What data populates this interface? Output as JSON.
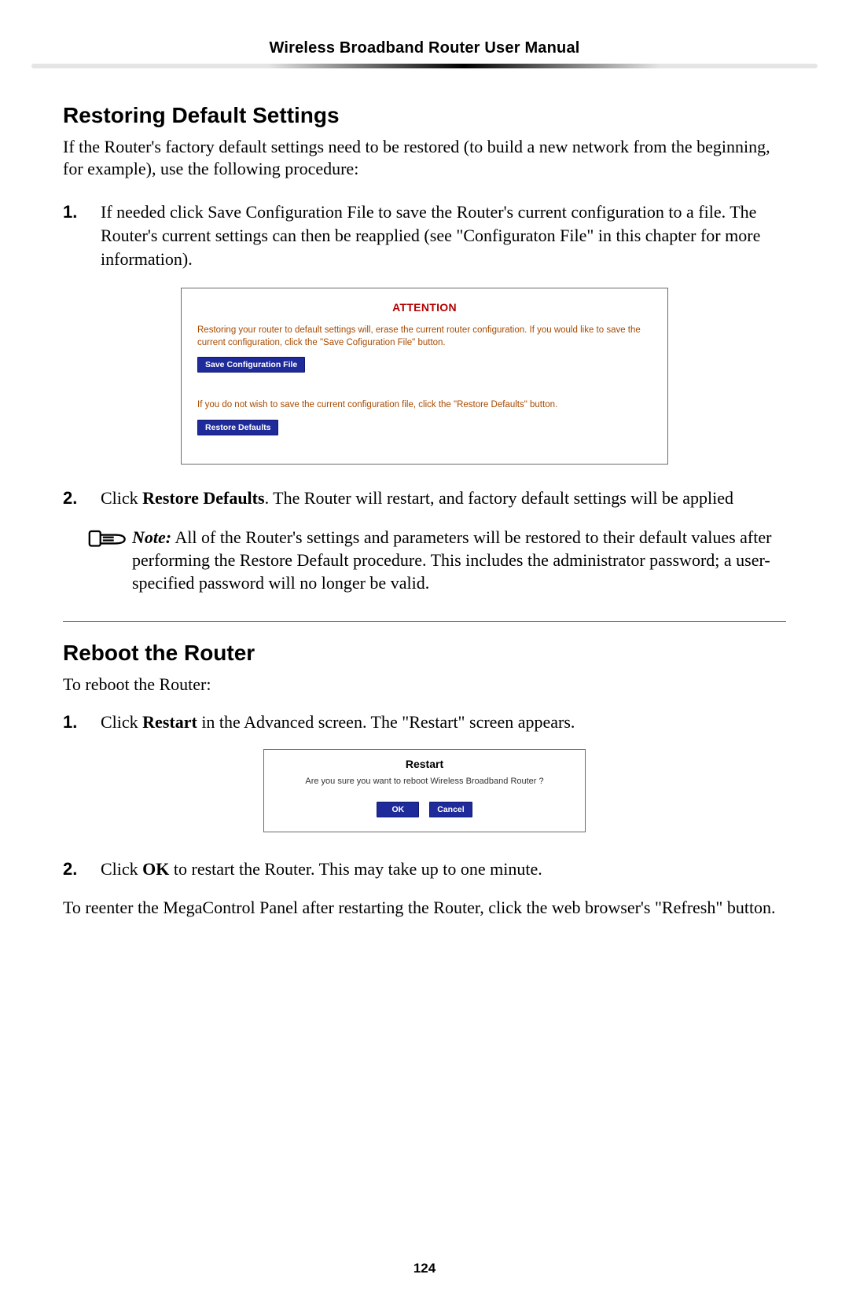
{
  "header": {
    "title": "Wireless Broadband Router User Manual"
  },
  "section1": {
    "heading": "Restoring Default Settings",
    "intro": "If the Router's factory default settings need to be restored (to build a new network from the beginning, for example), use the following procedure:",
    "step1": {
      "num": "1.",
      "text": "If needed click Save Configuration File to save the Router's current configuration to a file. The Router's current settings can then be reapplied (see \"Configuraton File\" in this chapter for more information)."
    },
    "attention": {
      "title": "ATTENTION",
      "msg1": "Restoring your router to default settings will, erase the current router configuration. If you would like to save the current configuration, click the \"Save Cofiguration File\" button.",
      "btn1": "Save Configuration File",
      "msg2": "If you do not wish to save the current configuration file, click the \"Restore Defaults\" button.",
      "btn2": "Restore Defaults"
    },
    "step2": {
      "num": "2.",
      "pre": "Click ",
      "bold": "Restore Defaults",
      "post": ". The Router will restart, and factory default settings will be applied"
    },
    "note": {
      "label": "Note:",
      "text": " All of the Router's settings and parameters will be restored to their default values after performing the Restore Default procedure. This includes the administrator password; a user-specified password will no longer be valid."
    }
  },
  "section2": {
    "heading": "Reboot the Router",
    "intro": "To reboot the Router:",
    "step1": {
      "num": "1.",
      "pre": "Click ",
      "bold": "Restart",
      "post": " in the Advanced screen. The \"Restart\" screen appears."
    },
    "restart": {
      "title": "Restart",
      "msg": "Are you sure you want to reboot Wireless Broadband Router ?",
      "ok": "OK",
      "cancel": "Cancel"
    },
    "step2": {
      "num": "2.",
      "pre": "Click ",
      "bold": "OK",
      "post": " to restart the Router. This may take up to one minute."
    },
    "closing": "To reenter the MegaControl Panel after restarting the Router, click the web browser's \"Refresh\" button."
  },
  "footer": {
    "page_num": "124"
  }
}
